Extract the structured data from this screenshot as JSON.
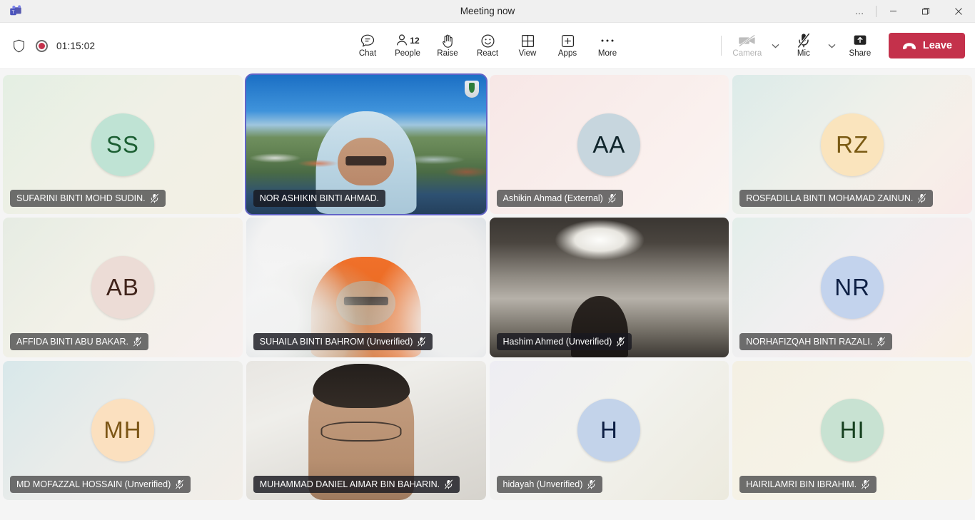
{
  "titlebar": {
    "title": "Meeting now",
    "app_icon": "teams-logo-icon",
    "more_label": "…",
    "minimize_label": "─",
    "maximize_label": "❐",
    "close_label": "✕"
  },
  "toolbar": {
    "shield_icon": "shield-icon",
    "record_icon": "record-indicator-icon",
    "timer": "01:15:02",
    "center_buttons": [
      {
        "id": "chat",
        "label": "Chat",
        "icon": "chat-icon",
        "badge": ""
      },
      {
        "id": "people",
        "label": "People",
        "icon": "people-icon",
        "badge": "12"
      },
      {
        "id": "raise",
        "label": "Raise",
        "icon": "raise-hand-icon",
        "badge": ""
      },
      {
        "id": "react",
        "label": "React",
        "icon": "react-smiley-icon",
        "badge": ""
      },
      {
        "id": "view",
        "label": "View",
        "icon": "view-grid-icon",
        "badge": ""
      },
      {
        "id": "apps",
        "label": "Apps",
        "icon": "apps-plus-icon",
        "badge": ""
      },
      {
        "id": "more",
        "label": "More",
        "icon": "more-ellipsis-icon",
        "badge": ""
      }
    ],
    "camera": {
      "label": "Camera",
      "icon": "camera-off-icon",
      "state": "off",
      "chevron": "chevron-down-icon"
    },
    "mic": {
      "label": "Mic",
      "icon": "mic-off-icon",
      "state": "off",
      "chevron": "chevron-down-icon"
    },
    "share": {
      "label": "Share",
      "icon": "share-screen-icon"
    },
    "leave": {
      "label": "Leave",
      "icon": "hangup-icon",
      "color": "#c4314b"
    }
  },
  "stage": {
    "rows": [
      [
        {
          "name": "SUFARINI BINTI MOHD SUDIN.",
          "type": "avatar",
          "initials": "SS",
          "avatar_bg": "#bfe3d4",
          "avatar_fg": "#1b5e32",
          "tile_bg": "linear-gradient(135deg,#e4efe3 0%,#f0f0e6 50%,#f3f0e4 100%)",
          "muted": true,
          "active_speaker": false,
          "label_style": "light"
        },
        {
          "name": "NOR ASHIKIN BINTI AHMAD.",
          "type": "video",
          "video_class": "vid-campus",
          "muted": false,
          "active_speaker": true,
          "label_style": "dark"
        },
        {
          "name": "Ashikin Ahmad (External)",
          "type": "avatar",
          "initials": "AA",
          "avatar_bg": "#c7d6de",
          "avatar_fg": "#10252b",
          "tile_bg": "linear-gradient(135deg,#f7e7e6 0%,#f9eeec 50%,#fbf4f1 100%)",
          "muted": true,
          "active_speaker": false,
          "label_style": "light"
        },
        {
          "name": "ROSFADILLA BINTI MOHAMAD ZAINUN.",
          "type": "avatar",
          "initials": "RZ",
          "avatar_bg": "#fae4bd",
          "avatar_fg": "#7a5a13",
          "tile_bg": "linear-gradient(135deg,#dcebe9 0%,#eef0ea 45%,#f7efe9 75%,#f8e9e8 100%)",
          "muted": true,
          "active_speaker": false,
          "label_style": "light"
        }
      ],
      [
        {
          "name": "AFFIDA BINTI ABU BAKAR.",
          "type": "avatar",
          "initials": "AB",
          "avatar_bg": "#ecdcd6",
          "avatar_fg": "#40231a",
          "tile_bg": "linear-gradient(135deg,#e6ece3 0%,#f2f1e8 45%,#f7f0ef 100%)",
          "muted": true,
          "active_speaker": false,
          "label_style": "light"
        },
        {
          "name": "SUHAILA BINTI BAHROM (Unverified)",
          "type": "video",
          "video_class": "vid-flowers",
          "muted": true,
          "active_speaker": false,
          "label_style": "dark"
        },
        {
          "name": "Hashim Ahmed (Unverified)",
          "type": "video",
          "video_class": "vid-darkroom",
          "muted": true,
          "active_speaker": false,
          "label_style": "dark"
        },
        {
          "name": "NORHAFIZQAH BINTI RAZALI.",
          "type": "avatar",
          "initials": "NR",
          "avatar_bg": "#c3d3ed",
          "avatar_fg": "#0d1f44",
          "tile_bg": "linear-gradient(135deg,#e3eeea 0%,#f0eff0 40%,#f7eeee 70%,#f8f1e4 100%)",
          "muted": true,
          "active_speaker": false,
          "label_style": "light"
        }
      ],
      [
        {
          "name": "MD MOFAZZAL HOSSAIN (Unverified)",
          "type": "avatar",
          "initials": "MH",
          "avatar_bg": "#fbe0bf",
          "avatar_fg": "#7c5616",
          "tile_bg": "linear-gradient(135deg,#d8e8ea 0%,#eaecea 45%,#f3efe9 100%)",
          "muted": true,
          "active_speaker": false,
          "label_style": "light"
        },
        {
          "name": "MUHAMMAD DANIEL AIMAR BIN BAHARIN.",
          "type": "video",
          "video_class": "vid-selfie",
          "muted": true,
          "active_speaker": false,
          "label_style": "dark"
        },
        {
          "name": "hidayah (Unverified)",
          "type": "avatar",
          "initials": "H",
          "avatar_bg": "#c3d3ea",
          "avatar_fg": "#0d1f44",
          "tile_bg": "linear-gradient(135deg,#eeedf3 0%,#f2f2ee 45%,#eceade 100%)",
          "muted": true,
          "active_speaker": false,
          "label_style": "light"
        },
        {
          "name": "HAIRILAMRI BIN IBRAHIM.",
          "type": "avatar",
          "initials": "HI",
          "avatar_bg": "#c8e2d2",
          "avatar_fg": "#16401f",
          "tile_bg": "linear-gradient(135deg,#f4f0e3 0%,#f6f3e7 50%,#f7f4ea 100%)",
          "muted": true,
          "active_speaker": false,
          "label_style": "light"
        }
      ]
    ]
  }
}
